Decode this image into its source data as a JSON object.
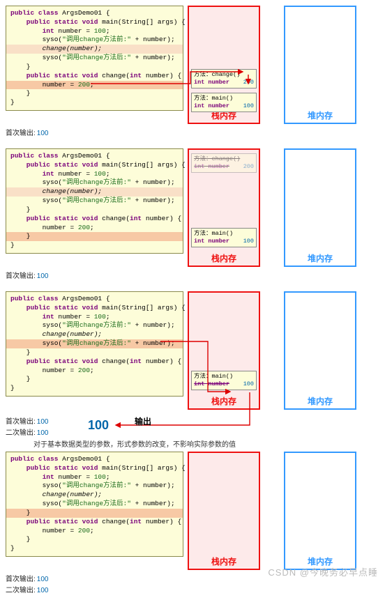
{
  "code": {
    "l1": "public class ArgsDemo01 {",
    "l2": "    public static void main(String[] args) {",
    "l3": "        int number = 100;",
    "l4_a": "        syso(\"",
    "l4_b": "调用change方法前:",
    "l4_c": "\" + number);",
    "l5": "        change(number);",
    "l6_a": "        syso(\"",
    "l6_b": "调用change方法后:",
    "l6_c": "\" + number);",
    "l7": "    }",
    "l8": "    public static void change(int number) {",
    "l9": "        number = 200;",
    "l10": "    }",
    "l11": "}"
  },
  "stack_label": "栈内存",
  "heap_label": "堆内存",
  "frames": {
    "change": {
      "header": "方法：change()",
      "var": "int number",
      "val": "200"
    },
    "main": {
      "header": "方法：main()",
      "var": "int number",
      "val": "100"
    }
  },
  "outputs": {
    "first_label": "首次输出:",
    "second_label": "二次输出:",
    "val": "100"
  },
  "panel3": {
    "shuchu": "输出",
    "big": "100"
  },
  "note": "对于基本数据类型的参数，形式参数的改变，不影响实际参数的值",
  "watermark": "CSDN @今晚务必早点睡"
}
